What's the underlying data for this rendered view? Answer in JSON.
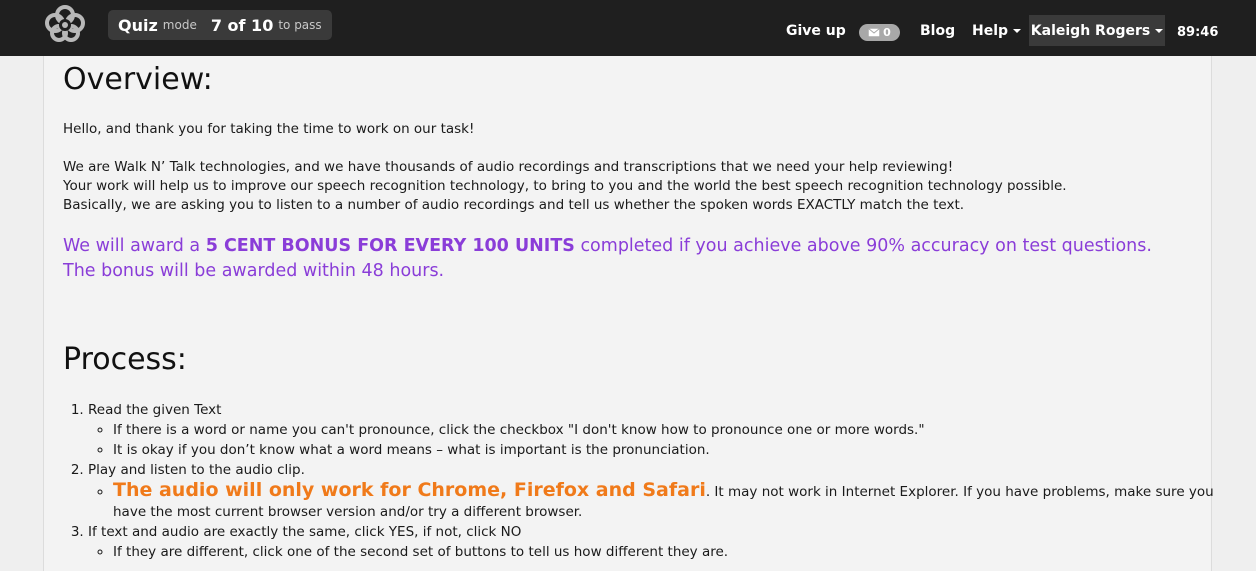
{
  "navbar": {
    "logo_icon": "flower-logo-icon",
    "mode": {
      "label": "Quiz",
      "suffix": "mode",
      "progress": "7 of 10",
      "progress_suffix": "to pass"
    },
    "give_up": "Give up",
    "messages": {
      "icon": "envelope-icon",
      "count": "0"
    },
    "blog": "Blog",
    "help": "Help",
    "user": "Kaleigh Rogers",
    "timer": "89:46"
  },
  "overview": {
    "title": "Overview:",
    "greeting": "Hello, and thank you for taking the time to work on our task!",
    "lines": [
      "We are Walk N’ Talk technologies, and we have thousands of audio recordings and transcriptions that we need your help reviewing!",
      "Your work will help us to improve our speech recognition technology, to bring to you and the world the best speech recognition technology possible.",
      "Basically, we are asking you to listen to a number of audio recordings and tell us whether the spoken words EXACTLY match the text."
    ],
    "bonus_pre": "We will award a ",
    "bonus_bold": "5 CENT BONUS FOR EVERY 100 UNITS",
    "bonus_post": " completed if you achieve above 90% accuracy on test questions. The bonus will be awarded within 48 hours.",
    "bonus_color": "#8a3dd8"
  },
  "process": {
    "title": "Process:",
    "step1": "Read the given Text",
    "step1_sub1": "If there is a word or name you can't pronounce, click the checkbox \"I don't know how to pronounce one or more words.\"",
    "step1_sub2": "It is okay if you don’t know what a word means – what is important is the pronunciation.",
    "step2": "Play and listen to the audio clip.",
    "step2_highlight": "The audio will only work for Chrome, Firefox and Safari",
    "step2_rest": ". It may not work in Internet Explorer. If you have problems, make sure you have the most current browser version and/or try a different browser.",
    "highlight_color": "#f07a1a",
    "step3": "If text and audio are exactly the same, click YES, if not, click NO",
    "step3_sub1": "If they are different, click one of the second set of buttons to tell us how different they are."
  }
}
